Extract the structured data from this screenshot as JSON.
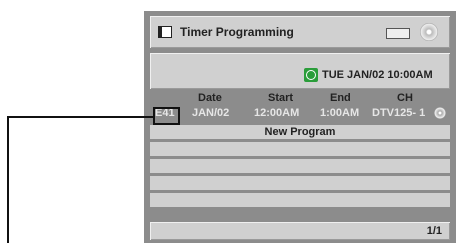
{
  "window": {
    "title": "Timer Programming",
    "icons": [
      "window-icon",
      "device-icon",
      "disc-icon"
    ]
  },
  "datetime": {
    "text": "TUE JAN/02 10:00AM",
    "icon": "clock-icon",
    "icon_color": "#2a9d3a"
  },
  "table": {
    "headers": [
      "Date",
      "Start",
      "End",
      "CH"
    ],
    "rows": [
      {
        "error": "E41",
        "date": "JAN/02",
        "start": "12:00AM",
        "end": "1:00AM",
        "ch": "DTV125- 1",
        "icon": "disc-icon"
      }
    ],
    "new_program": "New Program"
  },
  "footer": {
    "page": "1/1"
  },
  "colors": {
    "panel": "#8c8c8c",
    "bar": "#d0d0d0",
    "text": "#222222",
    "dim_text": "#e6e6e6"
  }
}
